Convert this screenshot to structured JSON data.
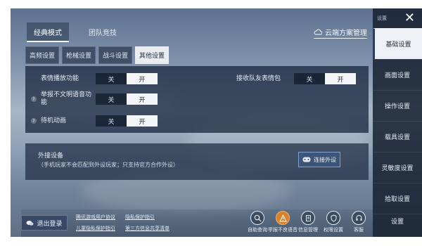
{
  "top_tabs": [
    "经典模式",
    "团队竞技"
  ],
  "cloud_mgmt": "云端方案管理",
  "sub_tabs": [
    "高频设置",
    "枪械设置",
    "战斗设置",
    "其他设置"
  ],
  "rows": {
    "emote_play": {
      "label": "表情播放功能",
      "off": "关",
      "on": "开",
      "value": "开"
    },
    "receive_team_emote": {
      "label": "接收队友表情包",
      "off": "关",
      "on": "开",
      "value": "开"
    },
    "report_voice": {
      "label": "举报不文明语音功能",
      "off": "关",
      "on": "开",
      "value": "开"
    },
    "idle_anim": {
      "label": "待机动画",
      "off": "关",
      "on": "开",
      "value": "开"
    }
  },
  "external": {
    "title": "外接设备",
    "desc": "（手机玩家不会匹配到外设玩家；只支持官方合作外设）",
    "button": "连接外设"
  },
  "bottom": {
    "logout": "退出登录",
    "links": [
      "腾讯游戏用户协议",
      "隐私保护指引",
      "儿童隐私保护指引",
      "第三方信息共享清单"
    ],
    "icons": [
      {
        "label": "自助查询",
        "icon": "search-icon"
      },
      {
        "label": "举报不良语音",
        "icon": "warning-icon"
      },
      {
        "label": "信息管理",
        "icon": "document-icon"
      },
      {
        "label": "权限设置",
        "icon": "shield-icon"
      },
      {
        "label": "客服",
        "icon": "headset-icon"
      }
    ]
  },
  "sidebar": {
    "header": "设置",
    "items": [
      "基础设置",
      "画面设置",
      "操作设置",
      "载具设置",
      "灵敏度设置",
      "拾取设置",
      "设置"
    ]
  },
  "colors": {
    "accent": "#2a3e5c",
    "active_bg": "#eef1f5",
    "warn": "#d9822b"
  }
}
